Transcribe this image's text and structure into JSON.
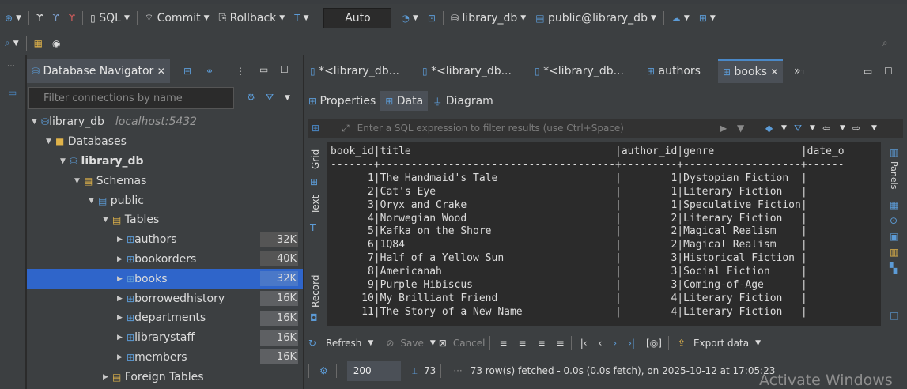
{
  "toolbar": {
    "sql_label": "SQL",
    "commit_label": "Commit",
    "rollback_label": "Rollback",
    "transaction_mode": "Auto",
    "active_datasource": "library_db",
    "active_schema": "public@library_db"
  },
  "navigator": {
    "tab_title": "Database Navigator",
    "filter_placeholder": "Filter connections by name",
    "connection_name": "library_db",
    "connection_host": "localhost:5432",
    "databases_label": "Databases",
    "database_name": "library_db",
    "schemas_label": "Schemas",
    "schema_name": "public",
    "tables_label": "Tables",
    "tables": [
      {
        "name": "authors",
        "size": "32K"
      },
      {
        "name": "bookorders",
        "size": "40K"
      },
      {
        "name": "books",
        "size": "32K"
      },
      {
        "name": "borrowedhistory",
        "size": "16K"
      },
      {
        "name": "departments",
        "size": "16K"
      },
      {
        "name": "librarystaff",
        "size": "16K"
      },
      {
        "name": "members",
        "size": "16K"
      }
    ],
    "foreign_tables_label": "Foreign Tables"
  },
  "editor": {
    "tabs": [
      "*<library_db...",
      "*<library_db...",
      "*<library_db...",
      "authors",
      "books",
      "»₁"
    ],
    "subtabs": [
      "Properties",
      "Data",
      "Diagram"
    ],
    "filter_placeholder": "Enter a SQL expression to filter results (use Ctrl+Space)",
    "side_tabs": [
      "Grid",
      "Text",
      "Record"
    ],
    "right_panel_label": "Panels",
    "grid_header": "book_id|title                                 |author_id|genre              |date_o",
    "grid_rule": "-------+--------------------------------------+---------+-------------------+------",
    "rows": [
      "      1|The Handmaid's Tale                   |        1|Dystopian Fiction  |",
      "      2|Cat's Eye                             |        1|Literary Fiction   |",
      "      3|Oryx and Crake                        |        1|Speculative Fiction|",
      "      4|Norwegian Wood                        |        2|Literary Fiction   |",
      "      5|Kafka on the Shore                    |        2|Magical Realism    |",
      "      6|1Q84                                  |        2|Magical Realism    |",
      "      7|Half of a Yellow Sun                  |        3|Historical Fiction |",
      "      8|Americanah                            |        3|Social Fiction     |",
      "      9|Purple Hibiscus                       |        3|Coming-of-Age      |",
      "     10|My Brilliant Friend                   |        4|Literary Fiction   |",
      "     11|The Story of a New Name               |        4|Literary Fiction   |"
    ],
    "refresh_label": "Refresh",
    "save_label": "Save",
    "cancel_label": "Cancel",
    "export_label": "Export data",
    "fetch_size": "200",
    "row_count": "73",
    "status_text": "73 row(s) fetched - 0.0s (0.0s fetch), on 2025-10-12 at 17:05:23"
  },
  "watermark": "Activate Windows",
  "colors": {
    "selection": "#2f65ca",
    "accent": "#4a88c7",
    "background": "#3c3f41"
  }
}
